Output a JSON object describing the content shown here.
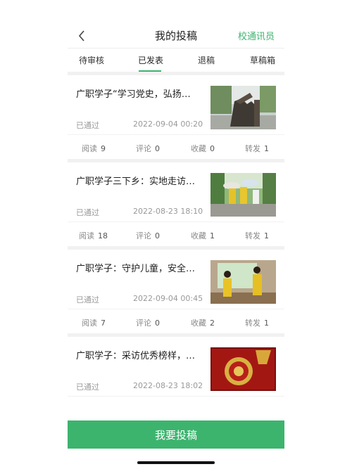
{
  "header": {
    "title": "我的投稿",
    "link": "校通讯员"
  },
  "tabs": [
    {
      "label": "待审核"
    },
    {
      "label": "已发表"
    },
    {
      "label": "退稿"
    },
    {
      "label": "草稿箱"
    }
  ],
  "active_tab": "已发表",
  "articles": [
    {
      "title": "广职学子“学习党史，弘扬…",
      "status": "已通过",
      "time": "2022-09-04 00:20",
      "stats": [
        {
          "label": "阅读",
          "value": "9"
        },
        {
          "label": "评论",
          "value": "0"
        },
        {
          "label": "收藏",
          "value": "0"
        },
        {
          "label": "转发",
          "value": "1"
        }
      ]
    },
    {
      "title": "广职学子三下乡：实地走访…",
      "status": "已通过",
      "time": "2022-08-23 18:10",
      "stats": [
        {
          "label": "阅读",
          "value": "18"
        },
        {
          "label": "评论",
          "value": "0"
        },
        {
          "label": "收藏",
          "value": "1"
        },
        {
          "label": "转发",
          "value": "1"
        }
      ]
    },
    {
      "title": "广职学子：守护儿童，安全…",
      "status": "已通过",
      "time": "2022-09-04 00:45",
      "stats": [
        {
          "label": "阅读",
          "value": "7"
        },
        {
          "label": "评论",
          "value": "0"
        },
        {
          "label": "收藏",
          "value": "2"
        },
        {
          "label": "转发",
          "value": "1"
        }
      ]
    },
    {
      "title": "广职学子：采访优秀榜样，…",
      "status": "已通过",
      "time": "2022-08-23 18:02"
    }
  ],
  "submit_button": "我要投稿",
  "colors": {
    "accent": "#3cb46e"
  }
}
